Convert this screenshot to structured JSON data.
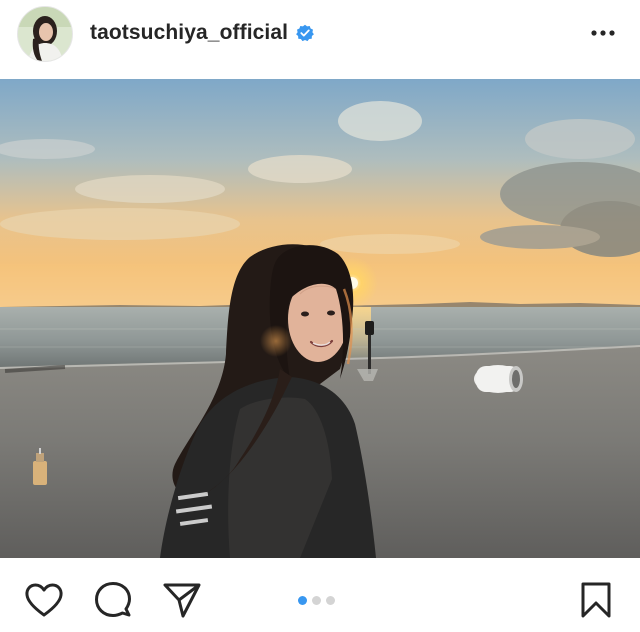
{
  "post": {
    "username": "taotsuchiya_official",
    "verified": true,
    "carousel": {
      "total": 3,
      "active_index": 0
    }
  },
  "icons": {
    "verified": "verified-badge-icon",
    "more": "more-options-icon",
    "like": "heart-icon",
    "comment": "comment-icon",
    "share": "paper-plane-icon",
    "save": "bookmark-icon"
  },
  "colors": {
    "accent": "#3897f0",
    "verified": "#3897f0",
    "text": "#262626",
    "dot_inactive": "#d4d4d4"
  }
}
